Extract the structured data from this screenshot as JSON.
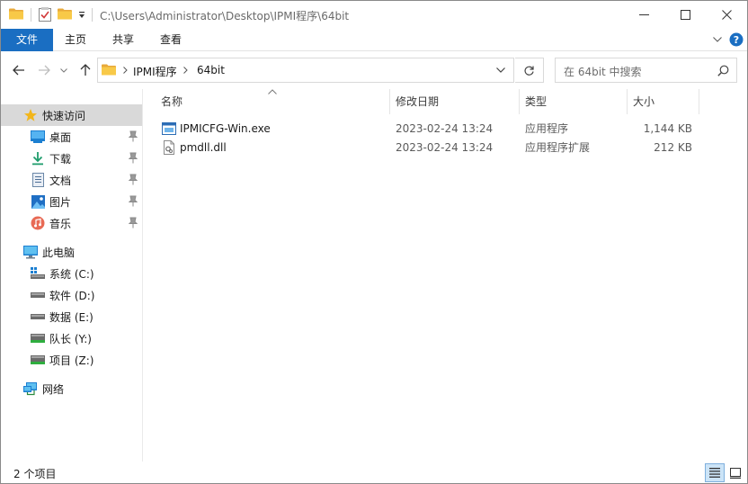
{
  "window": {
    "title_path": "C:\\Users\\Administrator\\Desktop\\IPMI程序\\64bit"
  },
  "ribbon": {
    "tabs": [
      {
        "label": "文件",
        "active": true
      },
      {
        "label": "主页"
      },
      {
        "label": "共享"
      },
      {
        "label": "查看"
      }
    ]
  },
  "address": {
    "segments": [
      "IPMI程序",
      "64bit"
    ]
  },
  "search": {
    "placeholder": "在 64bit 中搜索"
  },
  "sidebar": {
    "quick_access": "快速访问",
    "quick_items": [
      {
        "label": "桌面",
        "icon": "desktop-icon"
      },
      {
        "label": "下载",
        "icon": "download-icon"
      },
      {
        "label": "文档",
        "icon": "document-icon"
      },
      {
        "label": "图片",
        "icon": "pictures-icon"
      },
      {
        "label": "音乐",
        "icon": "music-icon"
      }
    ],
    "this_pc": "此电脑",
    "drives": [
      {
        "label": "系统 (C:)",
        "icon": "system-drive-icon"
      },
      {
        "label": "软件 (D:)",
        "icon": "drive-icon"
      },
      {
        "label": "数据 (E:)",
        "icon": "drive-icon"
      },
      {
        "label": "队长 (Y:)",
        "icon": "network-drive-icon"
      },
      {
        "label": "项目 (Z:)",
        "icon": "network-drive-icon"
      }
    ],
    "network": "网络"
  },
  "columns": {
    "name": "名称",
    "date": "修改日期",
    "type": "类型",
    "size": "大小"
  },
  "files": [
    {
      "name": "IPMICFG-Win.exe",
      "date": "2023-02-24 13:24",
      "type": "应用程序",
      "size": "1,144 KB",
      "icon": "exe-icon"
    },
    {
      "name": "pmdll.dll",
      "date": "2023-02-24 13:24",
      "type": "应用程序扩展",
      "size": "212 KB",
      "icon": "dll-icon"
    }
  ],
  "status": {
    "item_count": "2 个项目"
  },
  "colors": {
    "accent": "#1a6ec2",
    "folder": "#f5c242",
    "selection": "#d9d9d9"
  }
}
